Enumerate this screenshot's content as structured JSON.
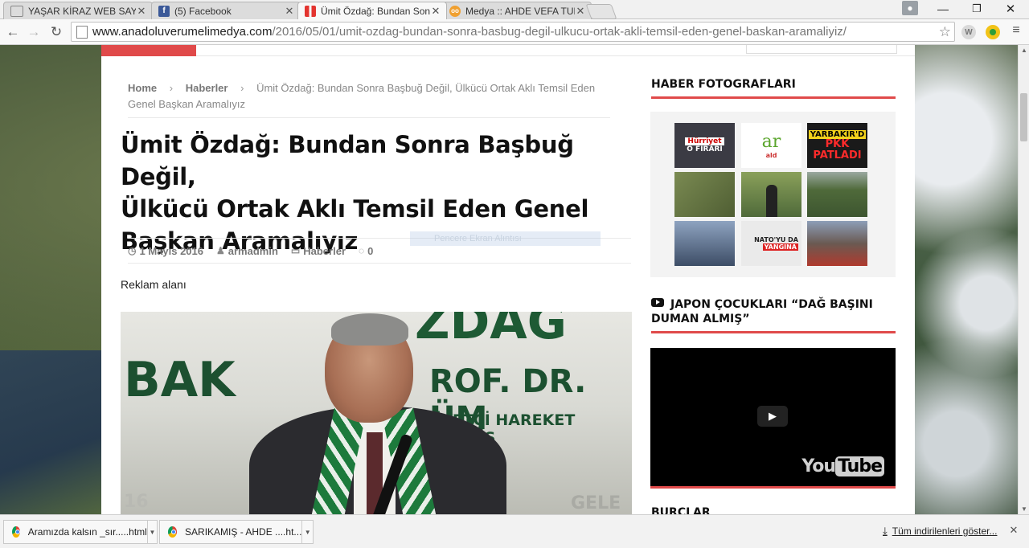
{
  "browser": {
    "tabs": [
      {
        "title": "YAŞAR KİRAZ WEB SAYFAS",
        "favicon": "page-icon",
        "active": false
      },
      {
        "title": "(5) Facebook",
        "favicon": "facebook-icon",
        "active": false
      },
      {
        "title": "Ümit Özdağ: Bundan Sonr",
        "favicon": "site-icon",
        "active": true
      },
      {
        "title": "Medya :: AHDE VEFA TUR",
        "favicon": "owl-icon",
        "active": false
      }
    ],
    "url_host": "www.anadoluverumelimedya.com",
    "url_path": "/2016/05/01/umit-ozdag-bundan-sonra-basbug-degil-ulkucu-ortak-akli-temsil-eden-genel-baskan-aramaliyiz/",
    "extensions": [
      {
        "icon": "w-extension-icon",
        "label": "W",
        "color": "#d9d9d9"
      },
      {
        "icon": "green-extension-icon",
        "label": "",
        "color": "#f2c318"
      }
    ]
  },
  "article": {
    "breadcrumb": {
      "home": "Home",
      "section": "Haberler",
      "sep": "›",
      "current": "Ümit Özdağ: Bundan Sonra Başbuğ Değil, Ülkücü Ortak Aklı Temsil Eden Genel Başkan Aramalıyız"
    },
    "title_line1": "Ümit Özdağ: Bundan Sonra Başbuğ Değil,",
    "title_line2": "Ülkücü Ortak Aklı Temsil Eden Genel",
    "title_line3": "Başkan Aramalıyız",
    "meta": {
      "date": "1 Mayıs 2016",
      "author": "armadmin",
      "category": "Haberler",
      "comments": "0"
    },
    "snip_overlay": "Pencere Ekran Alıntısı",
    "ad_label": "Reklam alanı",
    "hero_text": {
      "t1": "ZDAĞ",
      "t2": "BAK",
      "t3": "ROF. DR. ÜM",
      "t4": "İYETÇİ HAREKET PARTİS",
      "t5": "16",
      "t6": "GELE"
    }
  },
  "sidebar": {
    "photos_title": "HABER FOTOGRAFLARI",
    "thumbs": [
      {
        "caption": "Hürriyet",
        "caption2": "O FİRARİ",
        "bg": "#3b3b44"
      },
      {
        "caption": "ar",
        "caption2": "ald",
        "bg": "#ffffff"
      },
      {
        "caption": "YARBAKIR'D",
        "caption2": "PKK PATLADI",
        "bg": "#1a1a1a"
      },
      {
        "caption": "",
        "caption2": "",
        "bg": "#6d7a4a"
      },
      {
        "caption": "",
        "caption2": "",
        "bg": "#4f6a3a"
      },
      {
        "caption": "",
        "caption2": "",
        "bg": "#5a6e3c"
      },
      {
        "caption": "",
        "caption2": "",
        "bg": "#4c5f78"
      },
      {
        "caption": "NATO'YU DA",
        "caption2": "YANGINA",
        "bg": "#eaeaea"
      },
      {
        "caption": "",
        "caption2": "",
        "bg": "#6a5a52"
      }
    ],
    "video_title": "JAPON ÇOCUKLARI “DAĞ BAŞINI DUMAN ALMIŞ”",
    "video_logo_you": "You",
    "video_logo_tube": "Tube",
    "next_widget_title": "BURCLAR"
  },
  "downloads": {
    "items": [
      {
        "name": "Aramızda kalsın _sır.....html"
      },
      {
        "name": "SARIKAMIŞ - AHDE ....ht..."
      }
    ],
    "show_all": "Tüm indirilenleri göster..."
  },
  "colors": {
    "accent_red": "#e04a4a",
    "facebook_blue": "#3b5998",
    "site_red": "#e3342f"
  }
}
